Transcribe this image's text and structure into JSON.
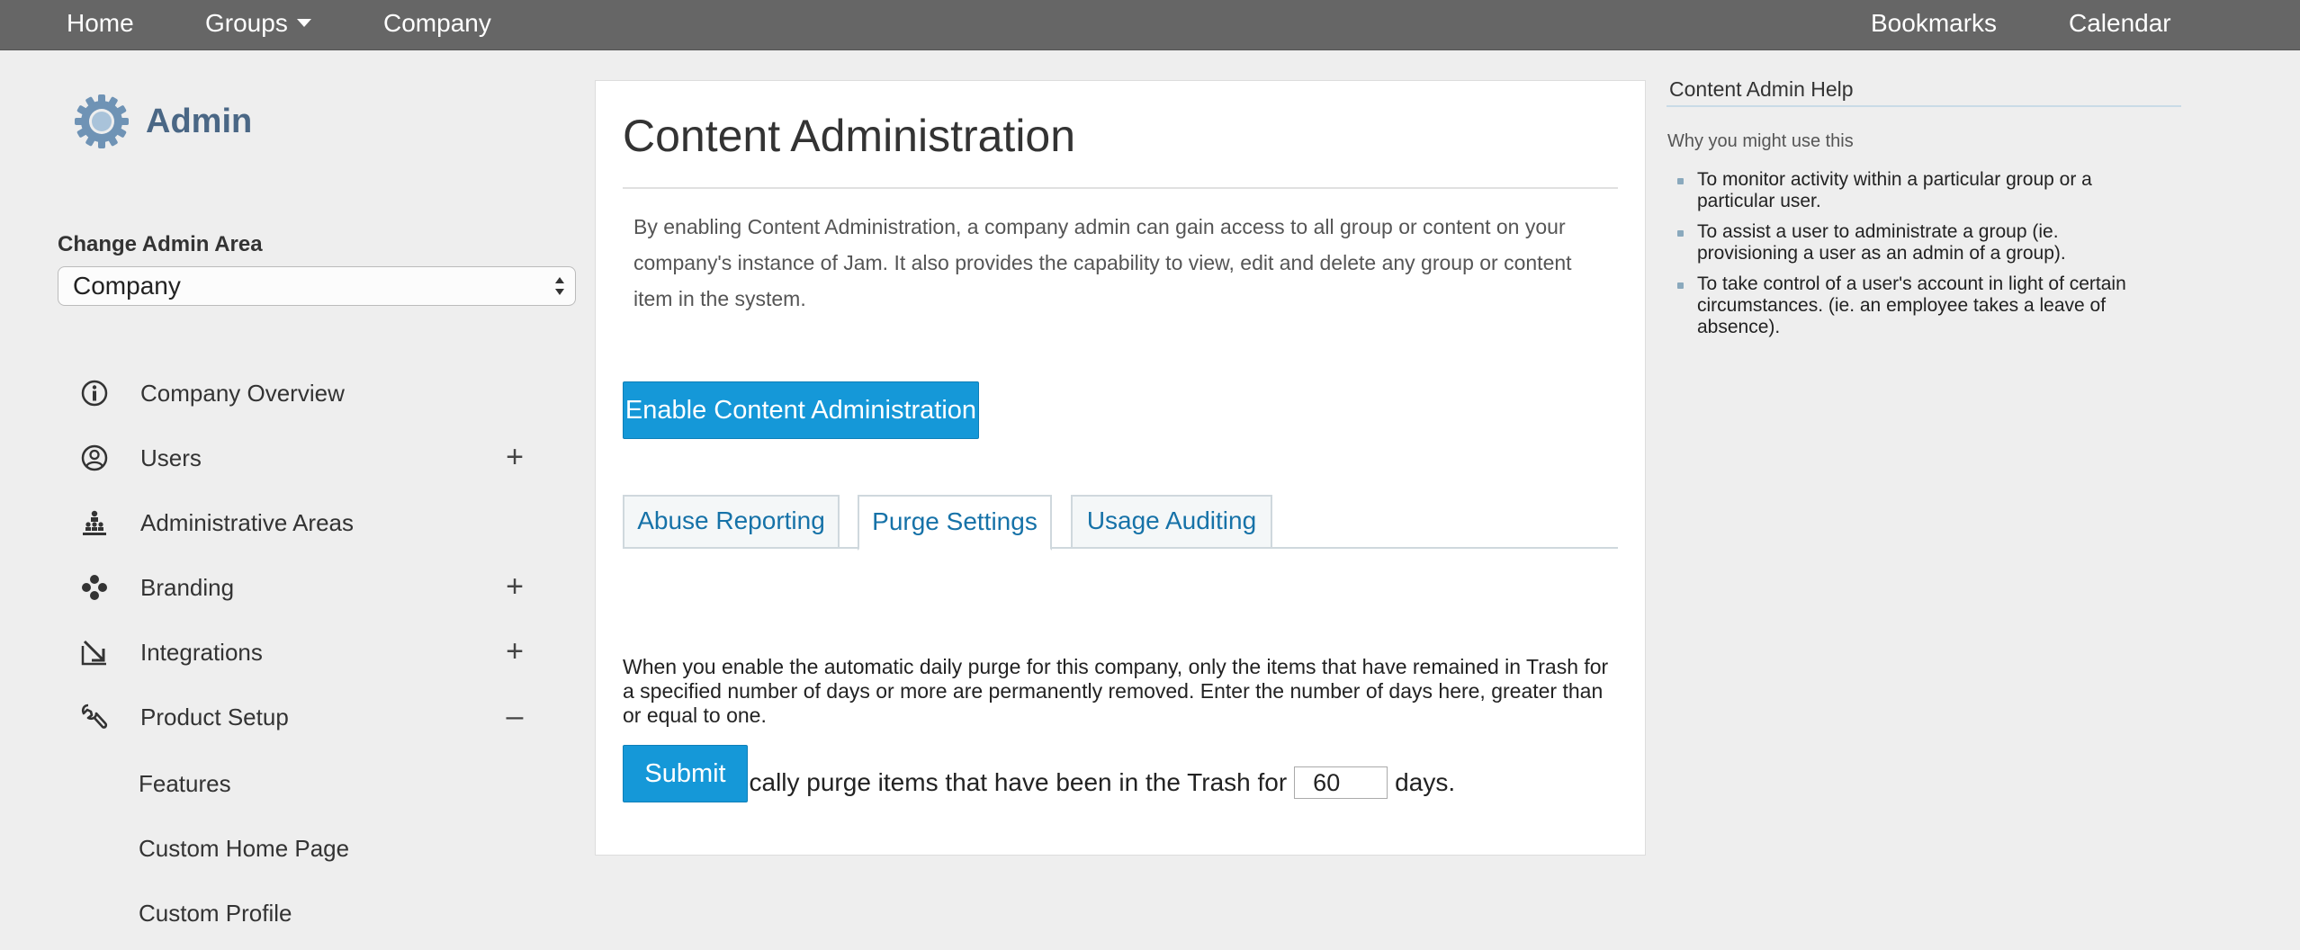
{
  "topnav": {
    "home": "Home",
    "groups": "Groups",
    "company": "Company",
    "bookmarks": "Bookmarks",
    "calendar": "Calendar"
  },
  "sidebar": {
    "title": "Admin",
    "change_area_label": "Change Admin Area",
    "area_selected": "Company",
    "items": [
      {
        "label": "Company Overview",
        "icon": "info-icon",
        "toggle": ""
      },
      {
        "label": "Users",
        "icon": "user-icon",
        "toggle": "+"
      },
      {
        "label": "Administrative Areas",
        "icon": "hierarchy-icon",
        "toggle": ""
      },
      {
        "label": "Branding",
        "icon": "paint-icon",
        "toggle": "+"
      },
      {
        "label": "Integrations",
        "icon": "arrow-in-icon",
        "toggle": "+"
      },
      {
        "label": "Product Setup",
        "icon": "wrench-icon",
        "toggle": "–"
      }
    ],
    "subitems": [
      "Features",
      "Custom Home Page",
      "Custom Profile"
    ]
  },
  "main": {
    "title": "Content Administration",
    "intro": "By enabling Content Administration, a company admin can gain access to all group or content on your company's instance of Jam. It also provides the capability to view, edit and delete any group or content item in the system.",
    "enable_button": "Enable Content Administration",
    "tabs": [
      {
        "label": "Abuse Reporting",
        "active": false
      },
      {
        "label": "Purge Settings",
        "active": true
      },
      {
        "label": "Usage Auditing",
        "active": false
      }
    ],
    "purge_description": "When you enable the automatic daily purge for this company, only the items that have remained in Trash for a specified number of days or more are permanently removed. Enter the number of days here, greater than or equal to one.",
    "purge_label_before": "Automatically purge items that have been in the Trash for",
    "purge_days_value": "60",
    "purge_label_after": "days.",
    "submit_button": "Submit"
  },
  "help": {
    "title": "Content Admin Help",
    "subtitle": "Why you might use this",
    "items": [
      "To monitor activity within a particular group or a particular user.",
      "To assist a user to administrate a group (ie. provisioning a user as an admin of a group).",
      "To take control of a user's account in light of certain circumstances. (ie. an employee takes a leave of absence)."
    ]
  },
  "colors": {
    "topbar": "#666666",
    "accent_button": "#1598d8",
    "admin_title": "#4a6785",
    "tab_text": "#1672a8",
    "background": "#eeeeee"
  }
}
